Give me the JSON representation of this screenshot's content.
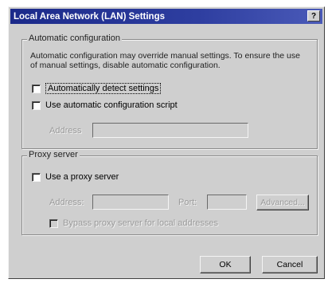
{
  "window": {
    "title": "Local Area Network (LAN) Settings",
    "help_label": "?"
  },
  "auto_config": {
    "group_label": "Automatic configuration",
    "description": "Automatic configuration may override manual settings.  To ensure the use of manual settings, disable automatic configuration.",
    "detect_label": "Automatically detect settings",
    "script_label": "Use automatic configuration script",
    "address_label": "Address",
    "address_value": ""
  },
  "proxy": {
    "group_label": "Proxy server",
    "use_proxy_label": "Use a proxy server",
    "address_label": "Address:",
    "address_value": "",
    "port_label": "Port:",
    "port_value": "",
    "advanced_label": "Advanced...",
    "bypass_label": "Bypass proxy server for local addresses"
  },
  "buttons": {
    "ok_label": "OK",
    "cancel_label": "Cancel"
  }
}
